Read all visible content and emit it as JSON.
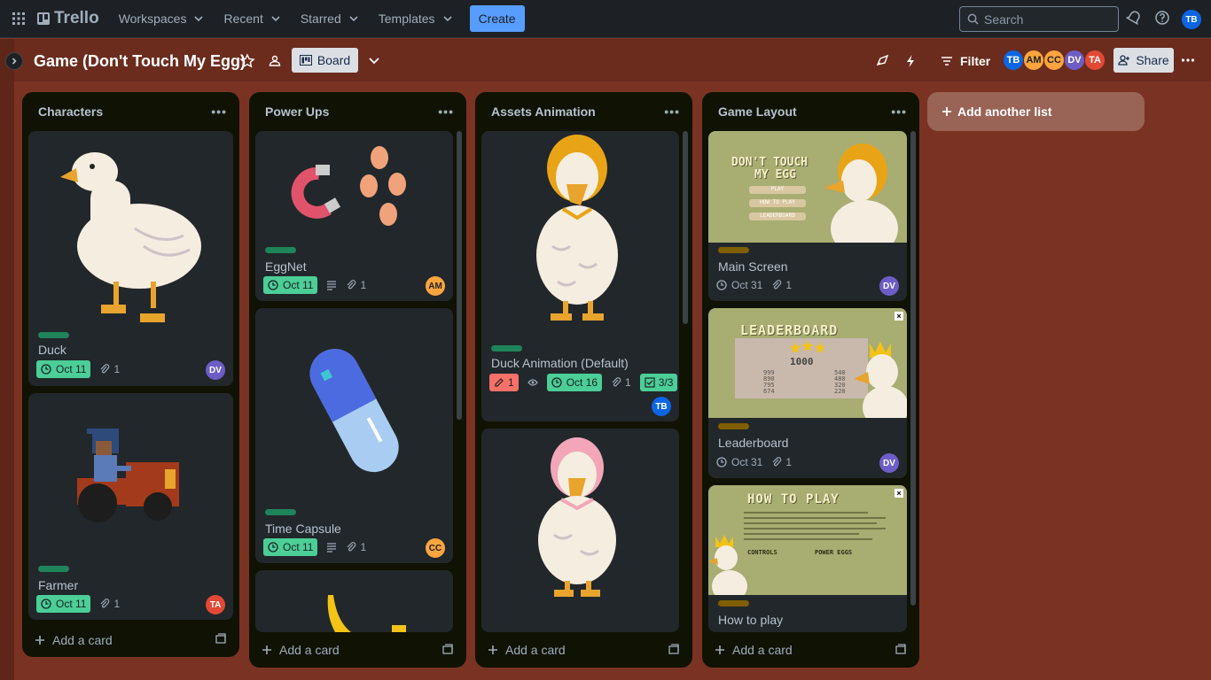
{
  "topbar": {
    "app_name": "Trello",
    "nav": [
      "Workspaces",
      "Recent",
      "Starred",
      "Templates"
    ],
    "create_label": "Create",
    "search_placeholder": "Search",
    "user_initials": "TB"
  },
  "board": {
    "title": "Game (Don't Touch My Egg)",
    "view_label": "Board",
    "filter_label": "Filter",
    "share_label": "Share",
    "members": [
      {
        "initials": "TB",
        "color": "#0c66e4"
      },
      {
        "initials": "AM",
        "color": "#faa53d"
      },
      {
        "initials": "CC",
        "color": "#faa53d"
      },
      {
        "initials": "DV",
        "color": "#6e5dc6"
      },
      {
        "initials": "TA",
        "color": "#e34935"
      }
    ],
    "add_list_label": "Add another list",
    "add_card_label": "Add a card"
  },
  "lists": [
    {
      "title": "Characters",
      "cards": [
        {
          "title": "Duck",
          "due": "Oct 11",
          "attachments": "1",
          "member": "DV",
          "member_color": "#6e5dc6",
          "label_color": "#1f845a"
        },
        {
          "title": "Farmer",
          "due": "Oct 11",
          "attachments": "1",
          "member": "TA",
          "member_color": "#e34935",
          "label_color": "#1f845a"
        }
      ]
    },
    {
      "title": "Power Ups",
      "cards": [
        {
          "title": "EggNet",
          "due": "Oct 11",
          "attachments": "1",
          "member": "AM",
          "member_color": "#faa53d",
          "label_color": "#1f845a"
        },
        {
          "title": "Time Capsule",
          "due": "Oct 11",
          "attachments": "1",
          "member": "CC",
          "member_color": "#faa53d",
          "label_color": "#1f845a"
        }
      ]
    },
    {
      "title": "Assets Animation",
      "cards": [
        {
          "title": "Duck Animation (Default)",
          "votes": "1",
          "due": "Oct 16",
          "attachments": "1",
          "checklist": "3/3",
          "member": "TB",
          "member_color": "#0c66e4",
          "label_color": "#1f845a"
        }
      ]
    },
    {
      "title": "Game Layout",
      "cards": [
        {
          "title": "Main Screen",
          "due": "Oct 31",
          "attachments": "1",
          "member": "DV",
          "member_color": "#6e5dc6",
          "label_color": "#7f5f01"
        },
        {
          "title": "Leaderboard",
          "due": "Oct 31",
          "attachments": "1",
          "member": "DV",
          "member_color": "#6e5dc6",
          "label_color": "#7f5f01"
        },
        {
          "title": "How to play",
          "label_color": "#7f5f01"
        }
      ]
    }
  ],
  "covers": {
    "main_screen": {
      "title_line1": "DON'T TOUCH",
      "title_line2": "MY EGG",
      "buttons": [
        "PLAY",
        "HOW TO PLAY",
        "LEADERBOARD"
      ]
    },
    "leaderboard": {
      "heading": "LEADERBOARD",
      "top_score": "1000",
      "left_scores": [
        "999",
        "890",
        "795",
        "674"
      ],
      "right_scores": [
        "540",
        "480",
        "320",
        "220"
      ]
    },
    "how_to_play": {
      "heading": "HOW TO PLAY",
      "controls": "CONTROLS",
      "power_eggs": "POWER EGGS"
    }
  }
}
